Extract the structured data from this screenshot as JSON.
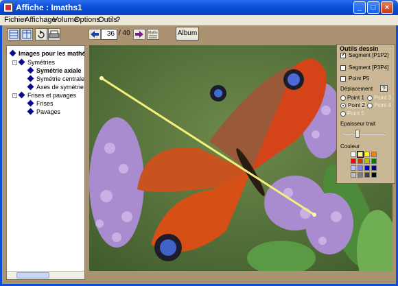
{
  "window": {
    "title": "Affiche : Imaths1",
    "minimize_label": "_",
    "maximize_label": "□",
    "close_label": "×"
  },
  "menu": [
    "Fichier",
    "Affichage",
    "Volume",
    "Options",
    "Outils",
    "?"
  ],
  "toolbar": {
    "page_current": "36",
    "page_total": "/ 40",
    "album_label": "Album"
  },
  "tree": {
    "root": "Images pour les mathé",
    "items": [
      {
        "label": "Symétries",
        "level": 1,
        "bold": false
      },
      {
        "label": "Symétrie axiale",
        "level": 2,
        "bold": true
      },
      {
        "label": "Symétrie centrale",
        "level": 2,
        "bold": false
      },
      {
        "label": "Axes de symétrie",
        "level": 2,
        "bold": false
      },
      {
        "label": "Frises et pavages",
        "level": 1,
        "bold": false
      },
      {
        "label": "Frises",
        "level": 2,
        "bold": false
      },
      {
        "label": "Pavages",
        "level": 2,
        "bold": false
      }
    ]
  },
  "tools_panel": {
    "title": "Outils dessin",
    "segment_p1p2": "Segment [P1P2]",
    "segment_p3p4": "Segment [P3P4]",
    "point_p5": "Point P5",
    "deplacement": "Déplacement",
    "help": "?",
    "point1": "Point 1",
    "point2": "Point 2",
    "point3": "Point 3",
    "point4": "Point 4",
    "point5": "Point 5",
    "epaisseur": "Epaisseur trait",
    "couleur": "Couleur",
    "segment_p1p2_checked": true,
    "segment_p3p4_checked": false,
    "point_p5_checked": false,
    "selected_point": "Point 2"
  },
  "palette": [
    "#ffffff",
    "#ffff80",
    "#ffff00",
    "#ff8000",
    "#ff0000",
    "#c04000",
    "#c0c000",
    "#008000",
    "#c0c0ff",
    "#8080ff",
    "#0000c0",
    "#000080",
    "#c0c0c0",
    "#808080",
    "#404040",
    "#000000"
  ],
  "colors": {
    "segment_line": "#f5f07a",
    "selected_palette": "#ffff80"
  }
}
